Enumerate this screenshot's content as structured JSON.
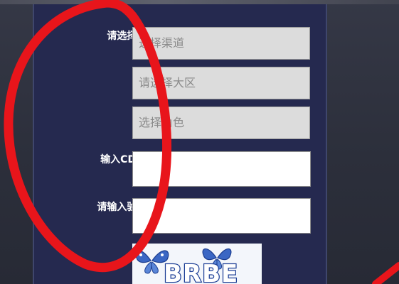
{
  "form": {
    "region_label": "请选择大区:",
    "channel_placeholder": "选择渠道",
    "region_placeholder": "请选择大区",
    "role_placeholder": "选择角色",
    "cdkey_label": "输入CDKEY:",
    "cdkey_value": "",
    "captcha_label": "请输入验证码:",
    "captcha_value": ""
  },
  "captcha": {
    "text": "BRBE"
  },
  "colors": {
    "panel": "#25294f",
    "select_bg": "#dcdcdc",
    "annotation": "#e8151b"
  }
}
